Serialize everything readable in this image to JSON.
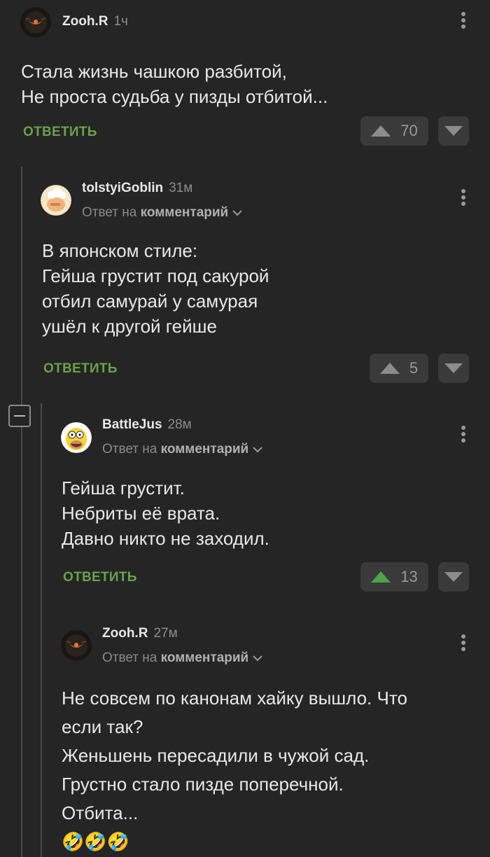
{
  "comments": [
    {
      "author": "Zooh.R",
      "time": "1ч",
      "body": [
        "Стала жизнь чашкою разбитой,",
        "Не проста судьба у пизды отбитой..."
      ],
      "reply_label": "ОТВЕТИТЬ",
      "rating": "70"
    },
    {
      "author": "tolstyiGoblin",
      "time": "31м",
      "reply_to_prefix": "Ответ на",
      "reply_to_target": "комментарий",
      "body": [
        "В японском стиле:",
        "Гейша грустит под сакурой",
        "отбил самурай у самурая",
        "ушёл к другой гейше"
      ],
      "reply_label": "ОТВЕТИТЬ",
      "rating": "5"
    },
    {
      "author": "BattleJus",
      "time": "28м",
      "reply_to_prefix": "Ответ на",
      "reply_to_target": "комментарий",
      "body": [
        "Гейша грустит.",
        "Небриты её врата.",
        "Давно никто не заходил."
      ],
      "reply_label": "ОТВЕТИТЬ",
      "rating": "13"
    },
    {
      "author": "Zooh.R",
      "time": "27м",
      "reply_to_prefix": "Ответ на",
      "reply_to_target": "комментарий",
      "body": [
        "Не совсем по канонам хайку вышло. Что",
        "если так?",
        "Женьшень пересадили в чужой сад.",
        "Грустно стало пизде поперечной.",
        "Отбита..."
      ],
      "emoji": "🤣🤣🤣"
    }
  ],
  "colors": {
    "background": "#252525",
    "accent_green": "#6aa14a",
    "upvoted": "#4fa34a"
  },
  "icons": {
    "upvote": "triangle-up-icon",
    "downvote": "triangle-down-icon",
    "menu": "more-vertical-icon",
    "collapse": "minus-square-icon",
    "reply_chevron": "chevron-down-icon"
  }
}
